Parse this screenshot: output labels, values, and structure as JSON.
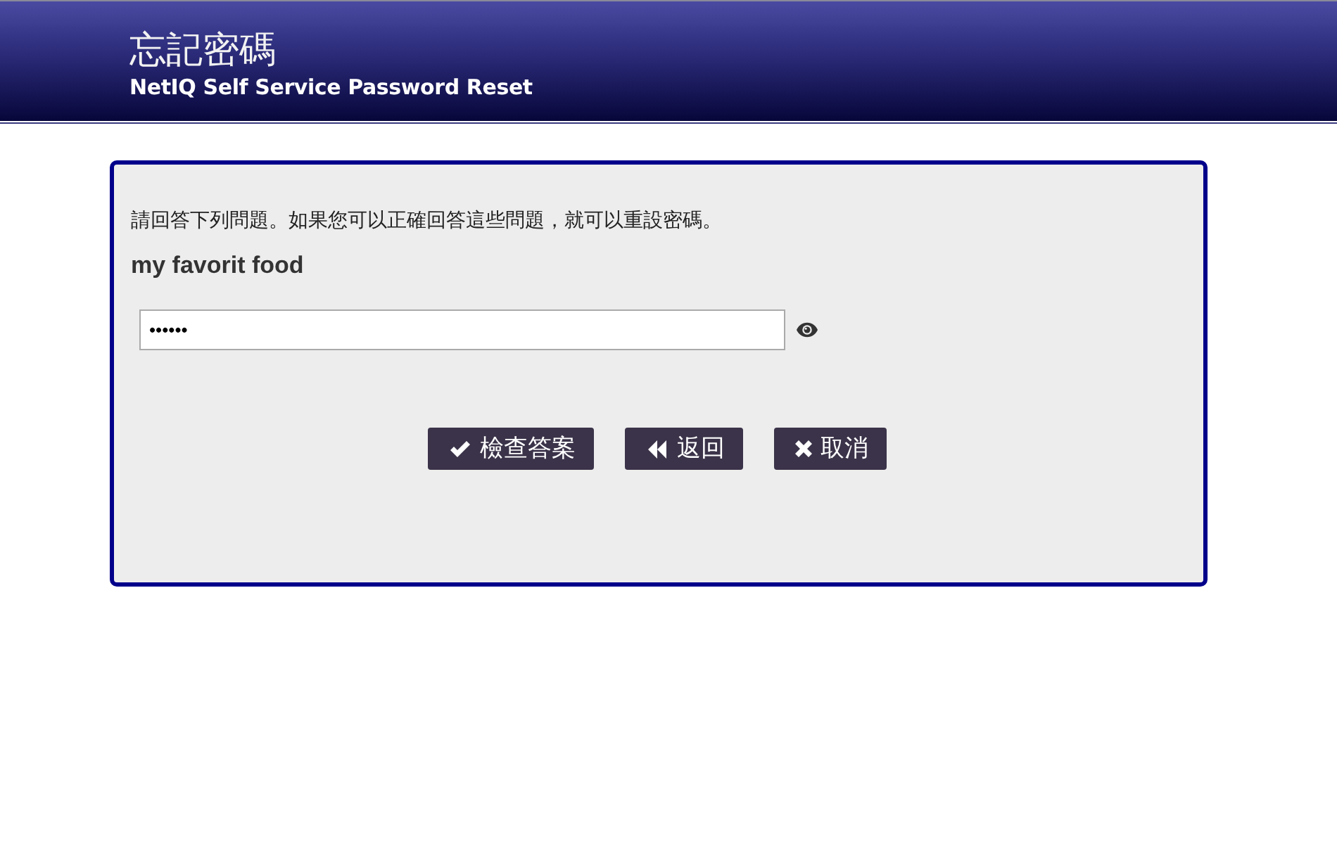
{
  "header": {
    "title": "忘記密碼",
    "subtitle": "NetIQ Self Service Password Reset"
  },
  "panel": {
    "instructions": "請回答下列問題。如果您可以正確回答這些問題，就可以重設密碼。",
    "question": {
      "label": "my favorit food",
      "answer": "••••••"
    }
  },
  "buttons": [
    {
      "kind": "check",
      "label": "檢查答案"
    },
    {
      "kind": "back",
      "label": "返回"
    },
    {
      "kind": "cancel",
      "label": "取消"
    }
  ]
}
